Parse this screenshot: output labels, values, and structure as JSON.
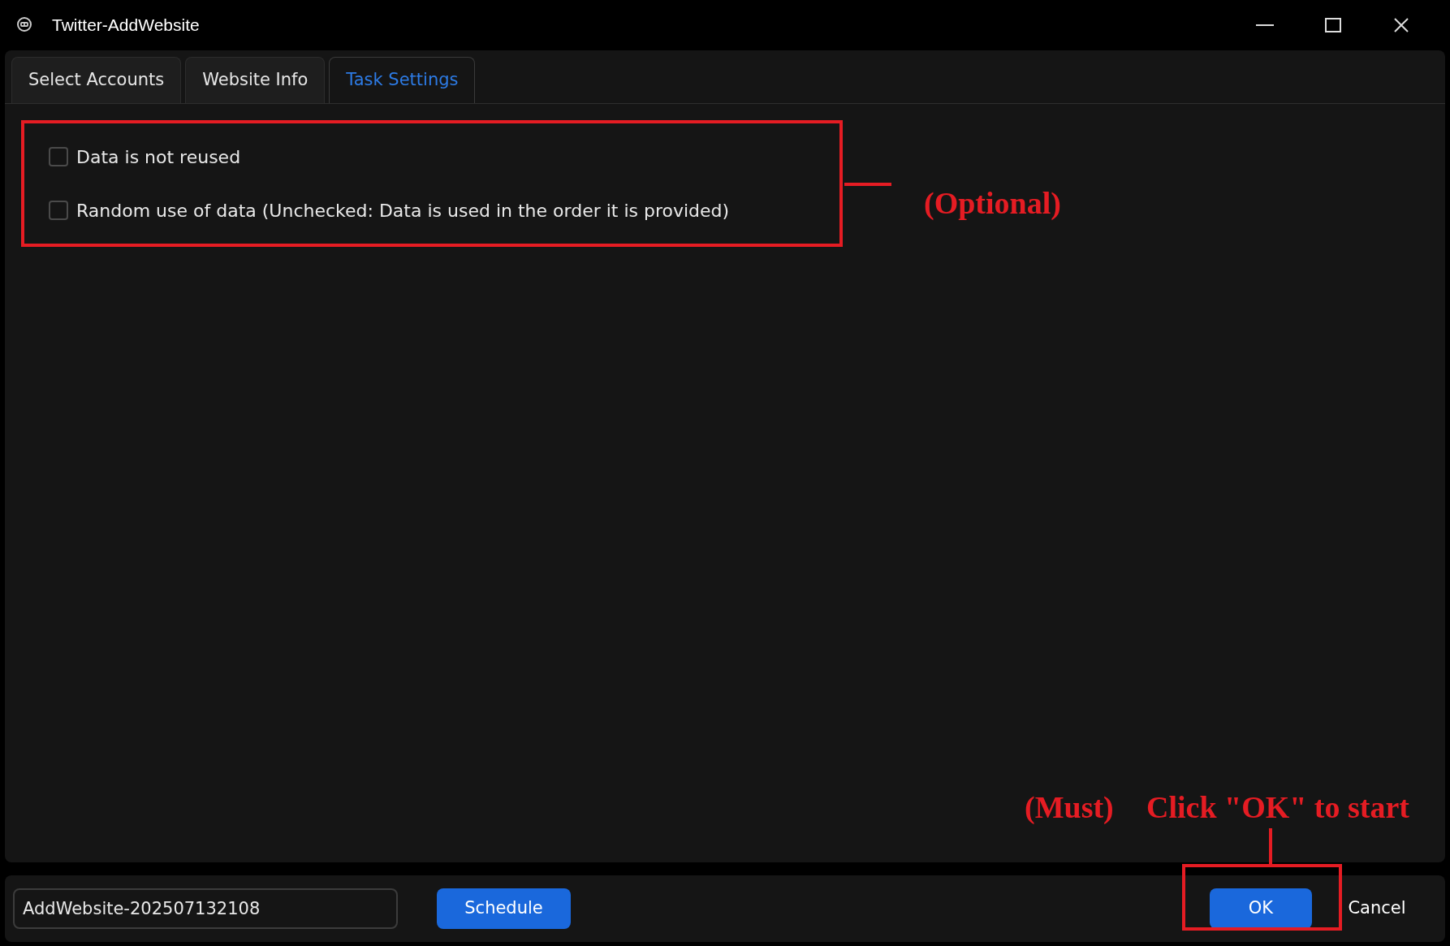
{
  "window": {
    "title": "Twitter-AddWebsite"
  },
  "tabs": [
    {
      "label": "Select Accounts",
      "selected": false
    },
    {
      "label": "Website Info",
      "selected": false
    },
    {
      "label": "Task Settings",
      "selected": true
    }
  ],
  "options": [
    {
      "label": "Data is not reused",
      "checked": false
    },
    {
      "label": "Random use of data (Unchecked: Data is used in the order it is provided)",
      "checked": false
    }
  ],
  "footer": {
    "task_name": "AddWebsite-202507132108",
    "schedule_button": "Schedule",
    "ok_button": "OK",
    "cancel_button": "Cancel"
  },
  "annotations": {
    "optional": "(Optional)",
    "must": "(Must)",
    "instruction": "Click \"OK\" to start"
  }
}
